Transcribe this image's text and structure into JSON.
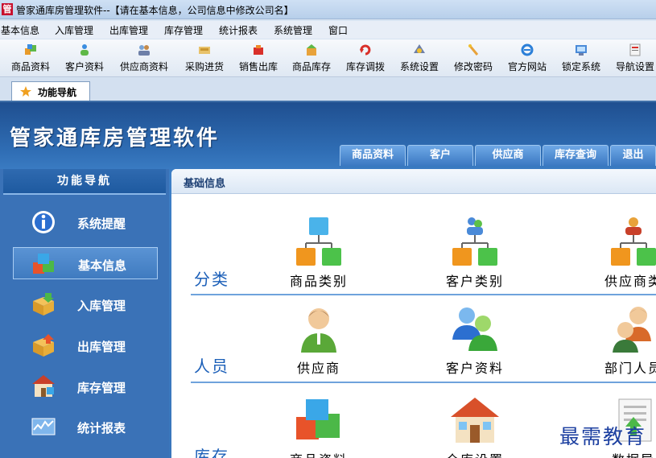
{
  "window": {
    "icon_glyph": "管",
    "title": "管家通库房管理软件--【请在基本信息，公司信息中修改公司名】"
  },
  "menubar": [
    "基本信息",
    "入库管理",
    "出库管理",
    "库存管理",
    "统计报表",
    "系统管理",
    "窗口"
  ],
  "toolbar": [
    {
      "label": "商品资料",
      "icon": "product-icon"
    },
    {
      "label": "客户资料",
      "icon": "customer-icon"
    },
    {
      "label": "供应商资料",
      "icon": "supplier-icon"
    },
    {
      "label": "采购进货",
      "icon": "purchase-icon"
    },
    {
      "label": "销售出库",
      "icon": "sales-icon"
    },
    {
      "label": "商品库存",
      "icon": "inventory-icon"
    },
    {
      "label": "库存调拨",
      "icon": "transfer-icon"
    },
    {
      "label": "系统设置",
      "icon": "settings-icon"
    },
    {
      "label": "修改密码",
      "icon": "password-icon"
    },
    {
      "label": "官方网站",
      "icon": "website-icon"
    },
    {
      "label": "锁定系统",
      "icon": "lock-icon"
    },
    {
      "label": "导航设置",
      "icon": "nav-settings-icon"
    }
  ],
  "doc_tab": {
    "label": "功能导航"
  },
  "app_title": "管家通库房管理软件",
  "top_tabs": [
    "商品资料",
    "客户",
    "供应商",
    "库存查询",
    "退出"
  ],
  "sidebar": {
    "header": "功能导航",
    "items": [
      {
        "label": "系统提醒",
        "icon": "info-icon",
        "active": false
      },
      {
        "label": "基本信息",
        "icon": "cubes-icon",
        "active": true
      },
      {
        "label": "入库管理",
        "icon": "box-in-icon",
        "active": false
      },
      {
        "label": "出库管理",
        "icon": "box-out-icon",
        "active": false
      },
      {
        "label": "库存管理",
        "icon": "warehouse-icon",
        "active": false
      },
      {
        "label": "统计报表",
        "icon": "chart-icon",
        "active": false
      }
    ]
  },
  "content": {
    "title": "基础信息",
    "sections": [
      {
        "label": "分类",
        "items": [
          {
            "label": "商品类别",
            "icon": "category-tree-icon"
          },
          {
            "label": "客户类别",
            "icon": "customer-tree-icon"
          },
          {
            "label": "供应商类",
            "icon": "supplier-tree-icon"
          }
        ]
      },
      {
        "label": "人员",
        "items": [
          {
            "label": "供应商",
            "icon": "person-icon"
          },
          {
            "label": "客户资料",
            "icon": "users-icon"
          },
          {
            "label": "部门人员",
            "icon": "staff-icon"
          }
        ]
      },
      {
        "label": "库存",
        "items": [
          {
            "label": "商品资料",
            "icon": "cubes-icon"
          },
          {
            "label": "仓库设置",
            "icon": "house-icon"
          },
          {
            "label": "数据导",
            "icon": "import-icon"
          }
        ]
      }
    ]
  },
  "watermark": "最需教育",
  "colors": {
    "accent": "#2f6db4",
    "sidebar": "#3a72b7",
    "section_text": "#1b5fb8"
  }
}
